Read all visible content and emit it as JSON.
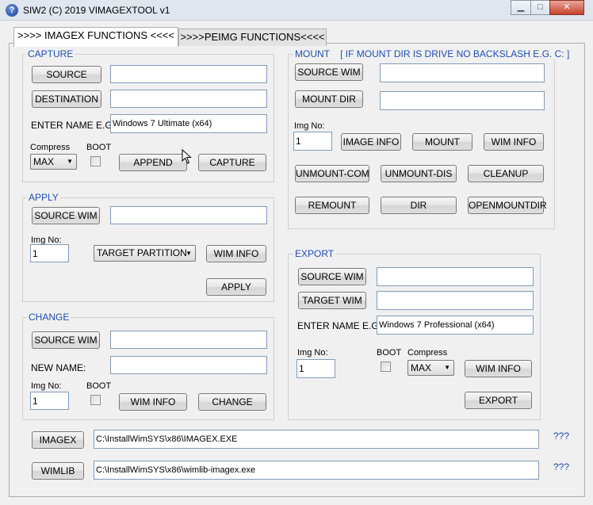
{
  "window": {
    "title": "SIW2 (C) 2019 VIMAGEXTOOL v1",
    "icon": "help-question-icon",
    "controls": {
      "minimize": "▁",
      "maximize": "□",
      "close": "✕"
    }
  },
  "tabs": [
    {
      "label": ">>>> IMAGEX FUNCTIONS <<<<",
      "active": true
    },
    {
      "label": ">>>>PEIMG FUNCTIONS<<<<",
      "active": false
    }
  ],
  "capture": {
    "title": "CAPTURE",
    "source_label": "SOURCE",
    "source_value": "",
    "destination_label": "DESTINATION",
    "destination_value": "",
    "enter_name_label": "ENTER NAME E.G.:",
    "name_value": "Windows 7 Ultimate (x64)",
    "compress_label": "Compress",
    "compress_value": "MAX",
    "boot_label": "BOOT",
    "append_label": "APPEND",
    "capture_label": "CAPTURE"
  },
  "apply": {
    "title": "APPLY",
    "source_wim_label": "SOURCE WIM",
    "source_wim_value": "",
    "img_no_label": "Img No:",
    "img_no_value": "1",
    "target_partition_label": "TARGET PARTITION",
    "wim_info_label": "WIM INFO",
    "apply_label": "APPLY"
  },
  "change": {
    "title": "CHANGE",
    "source_wim_label": "SOURCE WIM",
    "source_wim_value": "",
    "new_name_label": "NEW NAME:",
    "new_name_value": "",
    "img_no_label": "Img No:",
    "img_no_value": "1",
    "boot_label": "BOOT",
    "wim_info_label": "WIM INFO",
    "change_label": "CHANGE"
  },
  "mount": {
    "title": "MOUNT    [ IF MOUNT DIR IS DRIVE NO BACKSLASH E.G. C: ]",
    "source_wim_label": "SOURCE WIM",
    "source_wim_value": "",
    "mount_dir_label": "MOUNT DIR",
    "mount_dir_value": "",
    "img_no_label": "Img No:",
    "img_no_value": "1",
    "image_info_label": "IMAGE INFO",
    "mount_label": "MOUNT",
    "wim_info_label": "WIM INFO",
    "unmount_com_label": "UNMOUNT-COM",
    "unmount_dis_label": "UNMOUNT-DIS",
    "cleanup_label": "CLEANUP",
    "remount_label": "REMOUNT",
    "dir_label": "DIR",
    "openmountdir_label": "OPENMOUNTDIR"
  },
  "export": {
    "title": "EXPORT",
    "source_wim_label": "SOURCE WIM",
    "source_wim_value": "",
    "target_wim_label": "TARGET WIM",
    "target_wim_value": "",
    "enter_name_label": "ENTER NAME E.G.:",
    "name_value": "Windows 7 Professional (x64)",
    "img_no_label": "Img No:",
    "img_no_value": "1",
    "boot_label": "BOOT",
    "compress_label": "Compress",
    "compress_value": "MAX",
    "wim_info_label": "WIM INFO",
    "export_label": "EXPORT"
  },
  "paths": {
    "imagex_label": "IMAGEX",
    "imagex_value": "C:\\InstallWimSYS\\x86\\IMAGEX.EXE",
    "wimlib_label": "WIMLIB",
    "wimlib_value": "C:\\InstallWimSYS\\x86\\wimlib-imagex.exe",
    "help": "???"
  }
}
